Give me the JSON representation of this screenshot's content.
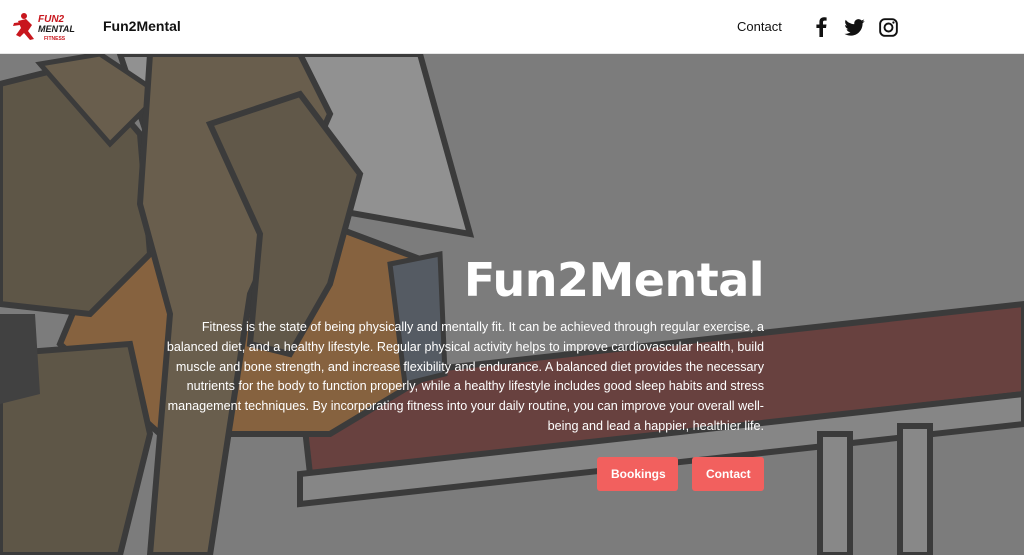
{
  "header": {
    "logo_alt": "Fun2Mental Fitness logo",
    "logo_text_top": "FUN2",
    "logo_text_mid": "MENTAL",
    "logo_text_bottom": "FITNESS",
    "brand_name": "Fun2Mental",
    "nav": {
      "contact_label": "Contact"
    },
    "social": [
      {
        "name": "facebook-icon"
      },
      {
        "name": "twitter-icon"
      },
      {
        "name": "instagram-icon"
      }
    ]
  },
  "hero": {
    "title": "Fun2Mental",
    "description": "Fitness is the state of being physically and mentally fit. It can be achieved through regular exercise, a balanced diet, and a healthy lifestyle. Regular physical activity helps to improve cardiovascular health, build muscle and bone strength, and increase flexibility and endurance. A balanced diet provides the necessary nutrients for the body to function properly, while a healthy lifestyle includes good sleep habits and stress management techniques. By incorporating fitness into your daily routine, you can improve your overall well-being and lead a happier, healthier life.",
    "buttons": {
      "bookings_label": "Bookings",
      "contact_label": "Contact"
    }
  },
  "colors": {
    "accent": "#f2605e",
    "overlay": "#7f7f7f",
    "header_bg": "#ffffff"
  }
}
